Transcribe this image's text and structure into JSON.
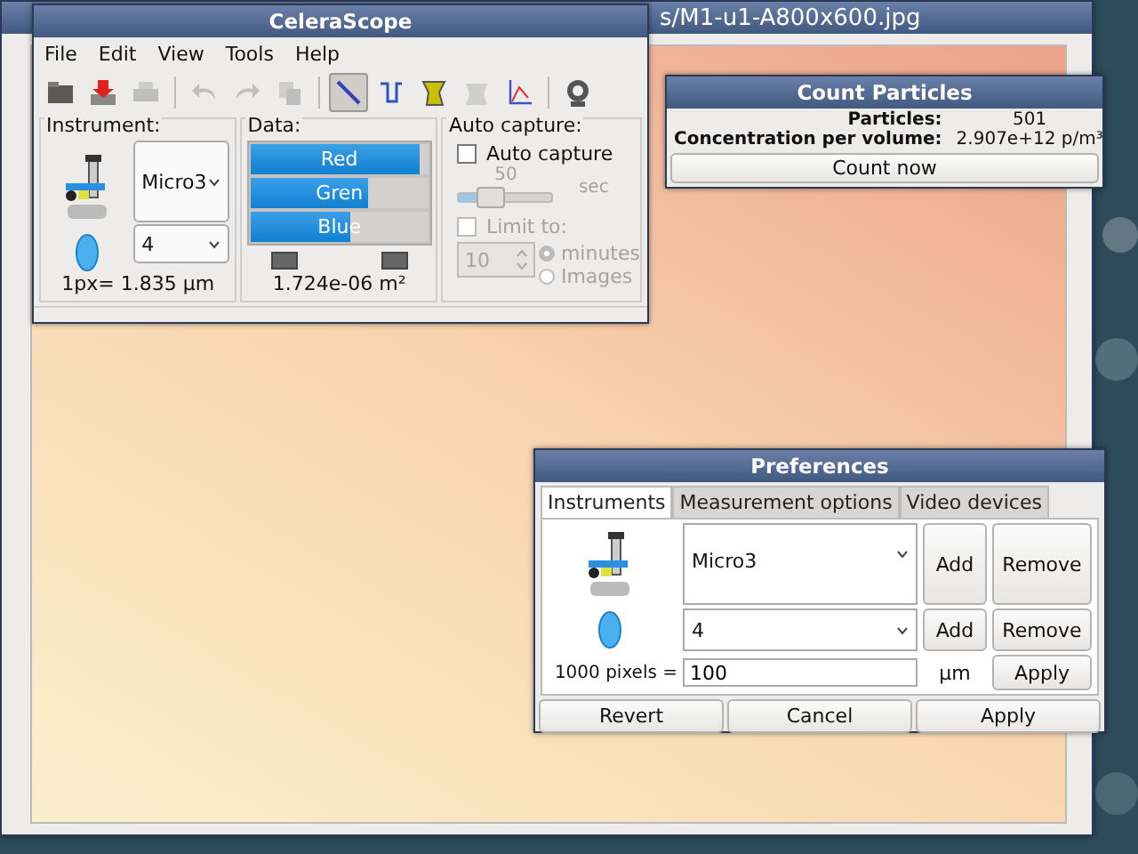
{
  "back_window": {
    "title": "s/M1-u1-A800x600.jpg"
  },
  "main_window": {
    "title": "CeleraScope",
    "menu": [
      "File",
      "Edit",
      "View",
      "Tools",
      "Help"
    ],
    "toolbar": [
      {
        "kind": "button",
        "disabled": false,
        "selected": false
      },
      {
        "kind": "button",
        "disabled": false,
        "selected": false
      },
      {
        "kind": "button",
        "disabled": true,
        "selected": false
      },
      {
        "kind": "separator"
      },
      {
        "kind": "button",
        "disabled": true,
        "selected": false
      },
      {
        "kind": "button",
        "disabled": true,
        "selected": false
      },
      {
        "kind": "button",
        "disabled": true,
        "selected": false
      },
      {
        "kind": "separator"
      },
      {
        "kind": "button",
        "disabled": false,
        "selected": true
      },
      {
        "kind": "button",
        "disabled": false,
        "selected": false
      },
      {
        "kind": "button",
        "disabled": false,
        "selected": false
      },
      {
        "kind": "button",
        "disabled": true,
        "selected": false
      },
      {
        "kind": "button",
        "disabled": false,
        "selected": false
      },
      {
        "kind": "separator"
      },
      {
        "kind": "button",
        "disabled": false,
        "selected": false
      }
    ],
    "instrument": {
      "label": "Instrument:",
      "microscope": "Micro3",
      "objective": "4",
      "scale": "1px= 1.835 µm"
    },
    "data": {
      "label": "Data:",
      "channels": [
        {
          "name": "Red",
          "level": 0.95
        },
        {
          "name": "Gren",
          "level": 0.66
        },
        {
          "name": "Blue",
          "level": 0.56
        }
      ],
      "area": "1.724e-06 m²"
    },
    "auto_capture": {
      "label": "Auto capture:",
      "checkbox": {
        "label": "Auto capture",
        "checked": false
      },
      "slider": {
        "reading": "50",
        "level": 0.3,
        "unit": "sec",
        "disabled": true
      },
      "limit": {
        "label": "Limit to:",
        "checked": false,
        "disabled": true
      },
      "spin": {
        "value": "10",
        "disabled": true
      },
      "options": [
        {
          "label": "minutes",
          "selected": true
        },
        {
          "label": "Images",
          "selected": false
        }
      ]
    }
  },
  "count_window": {
    "title": "Count Particles",
    "rows": [
      {
        "label": "Particles:",
        "value": "501"
      },
      {
        "label": "Concentration per volume:",
        "value": "2.907e+12 p/m³"
      }
    ],
    "button": "Count now"
  },
  "preferences": {
    "title": "Preferences",
    "tabs": [
      {
        "label": "Instruments",
        "selected": true
      },
      {
        "label": "Measurement options",
        "selected": false
      },
      {
        "label": "Video devices",
        "selected": false
      }
    ],
    "rows": [
      {
        "value": "Micro3",
        "add": "Add",
        "remove": "Remove"
      },
      {
        "value": "4",
        "add": "Add",
        "remove": "Remove"
      }
    ],
    "pixels_label": "1000 pixels =",
    "pixels_value": "100",
    "unit": "µm",
    "apply": "Apply",
    "buttons": [
      "Revert",
      "Cancel",
      "Apply"
    ]
  }
}
